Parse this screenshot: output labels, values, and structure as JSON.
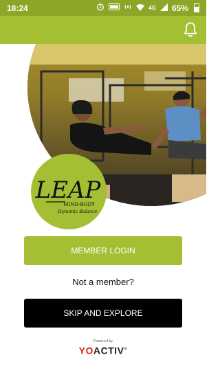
{
  "status_bar": {
    "time": "18:24",
    "network": "4G",
    "battery_percent": "65%",
    "icons": [
      "alarm-icon",
      "volte-icon",
      "hotspot-icon",
      "wifi-icon",
      "signal-icon",
      "battery-icon"
    ]
  },
  "app_bar": {
    "notification_icon": "bell-icon",
    "color": "#a4bf33"
  },
  "logo": {
    "text": "LEAP",
    "line1": "MIND-BODY",
    "line2": "Dynamic Balance"
  },
  "actions": {
    "member_login": "MEMBER LOGIN",
    "not_member": "Not a member?",
    "skip_explore": "SKIP AND EXPLORE"
  },
  "footer": {
    "powered_by": "Powered by",
    "brand_yo": "YO",
    "brand_activ": "ACTIV",
    "brand_mark": "®"
  },
  "colors": {
    "primary": "#a4bf33",
    "status": "#8ea628",
    "skip_button": "#000000",
    "brand_red": "#e2231a"
  }
}
